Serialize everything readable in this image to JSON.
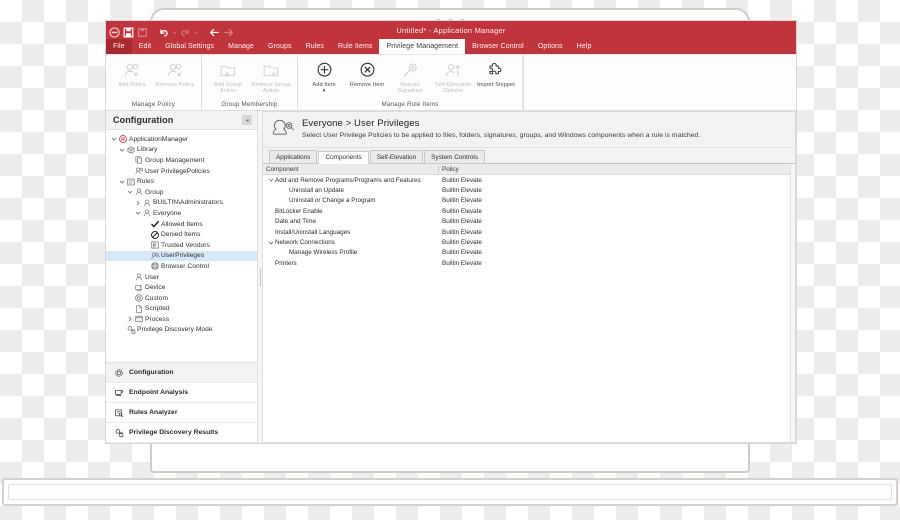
{
  "colors": {
    "ribbon_red": "#c0353c",
    "ribbon_red_dark": "#a82a31",
    "selection_blue": "#d6e7f7",
    "panel_gray": "#f2f2f2"
  },
  "window": {
    "title": "Untitled* - Application Manager",
    "quick_access": [
      {
        "name": "app-menu-icon",
        "label": "Application Menu"
      },
      {
        "name": "save-icon",
        "label": "Save"
      },
      {
        "name": "save-as-icon",
        "label": "Save As"
      },
      {
        "name": "undo-icon",
        "label": "Undo"
      },
      {
        "name": "undo-dropdown-icon",
        "label": "Undo History"
      },
      {
        "name": "redo-icon",
        "label": "Redo"
      },
      {
        "name": "redo-dropdown-icon",
        "label": "Redo History"
      },
      {
        "name": "back-arrow-icon",
        "label": "Back"
      },
      {
        "name": "forward-arrow-icon",
        "label": "Forward"
      }
    ]
  },
  "menubar": {
    "items": [
      {
        "label": "File",
        "state": "file"
      },
      {
        "label": "Edit",
        "state": "normal"
      },
      {
        "label": "Global Settings",
        "state": "normal"
      },
      {
        "label": "Manage",
        "state": "normal"
      },
      {
        "label": "Groups",
        "state": "normal"
      },
      {
        "label": "Rules",
        "state": "normal"
      },
      {
        "label": "Rule Items",
        "state": "normal"
      },
      {
        "label": "Privilege Management",
        "state": "active"
      },
      {
        "label": "Browser Control",
        "state": "normal"
      },
      {
        "label": "Options",
        "state": "normal"
      },
      {
        "label": "Help",
        "state": "normal"
      }
    ]
  },
  "ribbon": {
    "groups": [
      {
        "label": "Manage Policy",
        "buttons": [
          {
            "label": "Add Policy",
            "icon": "add-policy-icon",
            "disabled": true
          },
          {
            "label": "Remove Policy",
            "icon": "remove-policy-icon",
            "disabled": true
          }
        ]
      },
      {
        "label": "Group Membership",
        "buttons": [
          {
            "label": "Add Group Action",
            "icon": "add-group-action-icon",
            "disabled": true
          },
          {
            "label": "Remove Group Action",
            "icon": "remove-group-action-icon",
            "disabled": true
          }
        ]
      },
      {
        "label": "Manage Rule Items",
        "buttons": [
          {
            "label": "Add Item",
            "icon": "add-item-icon",
            "disabled": false,
            "has_dropdown": true
          },
          {
            "label": "Remove Item",
            "icon": "remove-item-icon",
            "disabled": false
          },
          {
            "label": "Rescan Signature",
            "icon": "rescan-signature-icon",
            "disabled": true
          },
          {
            "label": "Self-Elevation Options",
            "icon": "self-elevation-options-icon",
            "disabled": true
          },
          {
            "label": "Import Snippet",
            "icon": "import-snippet-icon",
            "disabled": false
          }
        ]
      }
    ]
  },
  "sidebar": {
    "title": "Configuration",
    "collapse_icon": "chevron-left-icon",
    "tree": [
      {
        "label": "ApplicationManager",
        "depth": 0,
        "twisty": "down",
        "icon": "application-manager-icon",
        "selected": false
      },
      {
        "label": "Library",
        "depth": 1,
        "twisty": "down",
        "icon": "library-icon",
        "selected": false
      },
      {
        "label": "Group Management",
        "depth": 2,
        "twisty": "none",
        "icon": "group-management-icon",
        "selected": false
      },
      {
        "label": "User PrivilegePolicies",
        "depth": 2,
        "twisty": "none",
        "icon": "user-privilege-policies-icon",
        "selected": false
      },
      {
        "label": "Rules",
        "depth": 1,
        "twisty": "down",
        "icon": "rules-icon",
        "selected": false
      },
      {
        "label": "Group",
        "depth": 2,
        "twisty": "down",
        "icon": "group-icon",
        "selected": false
      },
      {
        "label": "BUILTIN\\Administrators",
        "depth": 3,
        "twisty": "right",
        "icon": "group-icon",
        "selected": false
      },
      {
        "label": "Everyone",
        "depth": 3,
        "twisty": "down",
        "icon": "group-icon",
        "selected": false
      },
      {
        "label": "Allowed Items",
        "depth": 4,
        "twisty": "none",
        "icon": "allowed-items-icon",
        "selected": false
      },
      {
        "label": "Denied Items",
        "depth": 4,
        "twisty": "none",
        "icon": "denied-items-icon",
        "selected": false
      },
      {
        "label": "Trusted Vendors",
        "depth": 4,
        "twisty": "none",
        "icon": "trusted-vendors-icon",
        "selected": false
      },
      {
        "label": "UserPrivileges",
        "depth": 4,
        "twisty": "none",
        "icon": "user-privileges-icon",
        "selected": true
      },
      {
        "label": "Browser Control",
        "depth": 4,
        "twisty": "none",
        "icon": "browser-control-icon",
        "selected": false
      },
      {
        "label": "User",
        "depth": 2,
        "twisty": "none",
        "icon": "user-icon",
        "selected": false
      },
      {
        "label": "Device",
        "depth": 2,
        "twisty": "none",
        "icon": "device-icon",
        "selected": false
      },
      {
        "label": "Custom",
        "depth": 2,
        "twisty": "none",
        "icon": "custom-icon",
        "selected": false
      },
      {
        "label": "Scripted",
        "depth": 2,
        "twisty": "none",
        "icon": "scripted-icon",
        "selected": false
      },
      {
        "label": "Process",
        "depth": 2,
        "twisty": "right",
        "icon": "process-icon",
        "selected": false
      },
      {
        "label": "Privilege Discovery Mode",
        "depth": 1,
        "twisty": "none",
        "icon": "privilege-discovery-mode-icon",
        "selected": false
      }
    ],
    "nav": [
      {
        "label": "Configuration",
        "icon": "gear-icon",
        "active": true
      },
      {
        "label": "Endpoint Analysis",
        "icon": "endpoint-analysis-icon",
        "active": false
      },
      {
        "label": "Rules Analyzer",
        "icon": "rules-analyzer-icon",
        "active": false
      },
      {
        "label": "Privilege Discovery Results",
        "icon": "privilege-discovery-results-icon",
        "active": false
      }
    ]
  },
  "main": {
    "header_icon": "user-privileges-large-icon",
    "title": "Everyone > User Privileges",
    "subtitle": "Select User Privilege Policies to be applied to files, folders, signatures, groups, and Windows components when a rule is matched.",
    "tabs": [
      {
        "label": "Applications",
        "active": false
      },
      {
        "label": "Components",
        "active": true
      },
      {
        "label": "Self-Elevation",
        "active": false
      },
      {
        "label": "System Controls",
        "active": false
      }
    ],
    "grid": {
      "columns": [
        "Component",
        "Policy"
      ],
      "rows": [
        {
          "component": "Add and Remove Programs/Programs and Features",
          "policy": "Builtin Elevate",
          "depth": 0,
          "twisty": "down"
        },
        {
          "component": "Uninstall an Update",
          "policy": "Builtin Elevate",
          "depth": 1,
          "twisty": "none"
        },
        {
          "component": "Uninstall or Change a Program",
          "policy": "Builtin Elevate",
          "depth": 1,
          "twisty": "none"
        },
        {
          "component": "BitLocker Enable",
          "policy": "Builtin Elevate",
          "depth": 0,
          "twisty": "none"
        },
        {
          "component": "Date and Time",
          "policy": "Builtin Elevate",
          "depth": 0,
          "twisty": "none"
        },
        {
          "component": "Install/Uninstall Languages",
          "policy": "Builtin Elevate",
          "depth": 0,
          "twisty": "none"
        },
        {
          "component": "Network Connections",
          "policy": "Builtin Elevate",
          "depth": 0,
          "twisty": "down"
        },
        {
          "component": "Manage Wireless Profile",
          "policy": "Builtin Elevate",
          "depth": 1,
          "twisty": "none"
        },
        {
          "component": "Printers",
          "policy": "Builtin Elevate",
          "depth": 0,
          "twisty": "none"
        }
      ]
    }
  }
}
